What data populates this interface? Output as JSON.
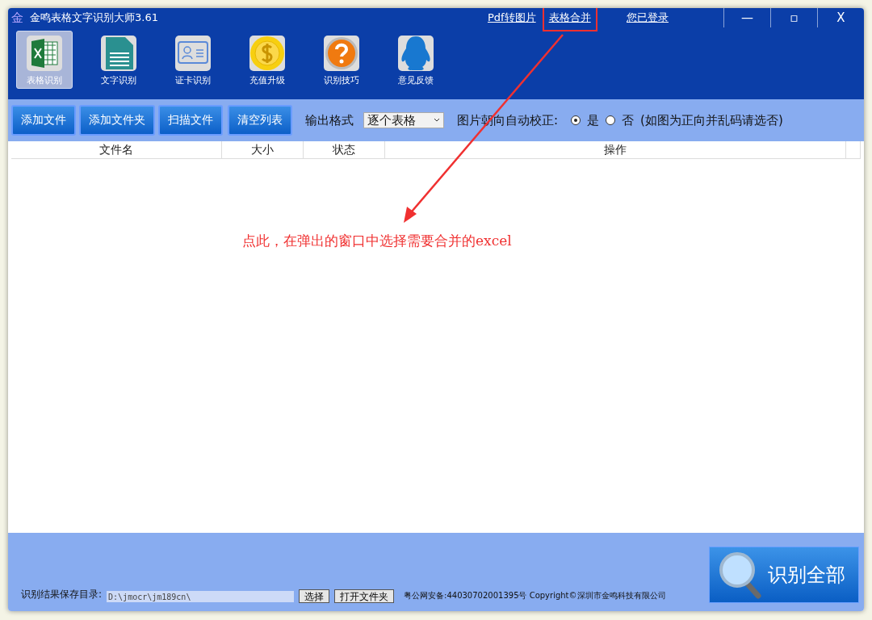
{
  "window": {
    "logo": "金",
    "title": "金鸣表格文字识别大师3.61",
    "links": [
      {
        "label": "Pdf转图片",
        "highlighted": false
      },
      {
        "label": "表格合并",
        "highlighted": true
      }
    ],
    "login": "您已登录",
    "controls": [
      "—",
      "▫",
      "X"
    ]
  },
  "tools": [
    {
      "label": "表格识别",
      "kind": "sheet",
      "selected": true
    },
    {
      "label": "文字识别",
      "kind": "document",
      "selected": false
    },
    {
      "label": "证卡识别",
      "kind": "card",
      "selected": false
    },
    {
      "label": "充值升级",
      "kind": "coin",
      "selected": false
    },
    {
      "label": "识别技巧",
      "kind": "help",
      "selected": false
    },
    {
      "label": "意见反馈",
      "kind": "person",
      "selected": false
    }
  ],
  "actions": [
    "添加文件",
    "添加文件夹",
    "扫描文件",
    "清空列表"
  ],
  "output_format": {
    "label": "输出格式",
    "value": "逐个表格"
  },
  "orientation": {
    "label": "图片朝向自动校正:",
    "options": [
      {
        "label": "是",
        "selected": true
      },
      {
        "label": "否",
        "selected": false
      }
    ],
    "note": "(如图为正向并乱码请选否)"
  },
  "table": {
    "columns": [
      "文件名",
      "大小",
      "状态",
      "操作"
    ]
  },
  "annotation": {
    "text": "点此，在弹出的窗口中选择需要合并的excel"
  },
  "footer": {
    "save_label": "识别结果保存目录:",
    "save_path": "D:\\jmocr\\jm189cn\\",
    "buttons": [
      "选择",
      "打开文件夹"
    ],
    "copyright": "粤公网安备:44030702001395号 Copyright©深圳市金鸣科技有限公司",
    "recognize_all": "识别全部"
  }
}
